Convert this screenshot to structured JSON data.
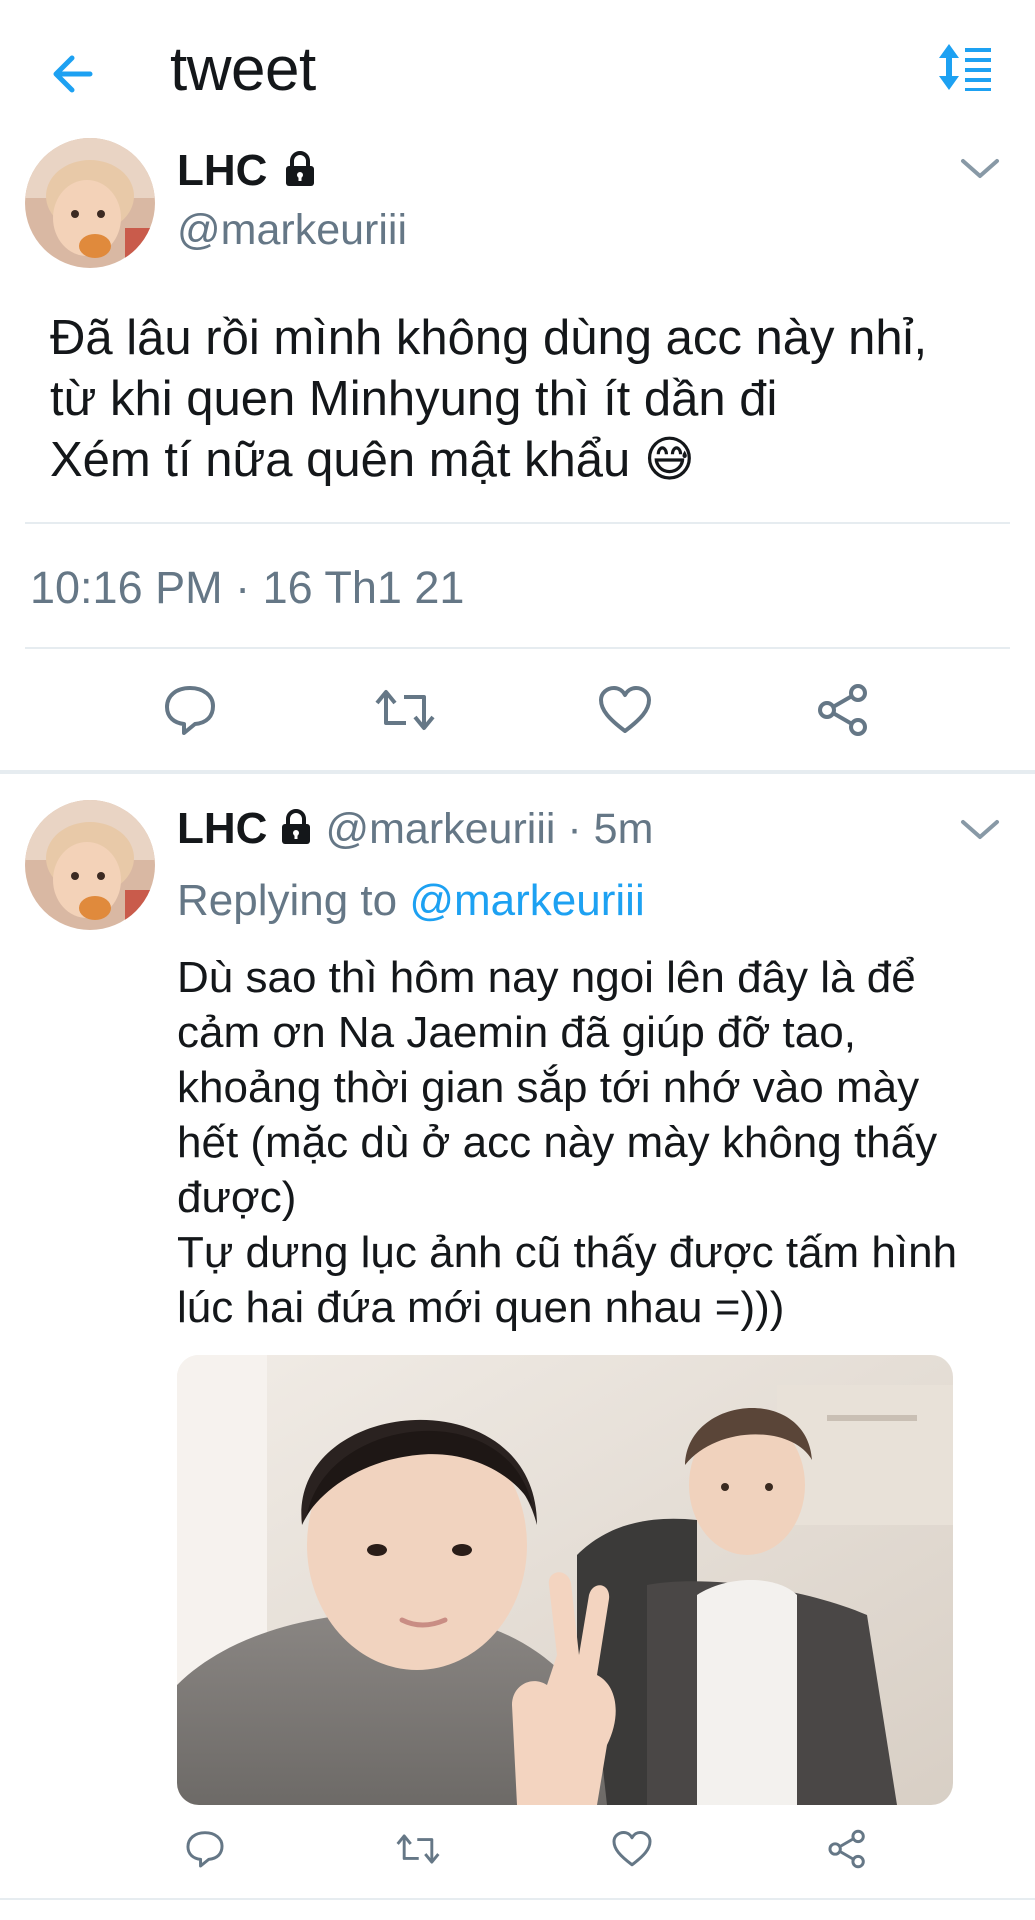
{
  "header": {
    "title": "tweet",
    "accent_color": "#1da1f2"
  },
  "main_tweet": {
    "display_name": "LHC",
    "handle": "@markeuriii",
    "text_lines": [
      "Đã lâu rồi mình không dùng acc này nhỉ,",
      "từ khi quen Minhyung thì ít dần đi",
      "Xém tí nữa quên mật khẩu"
    ],
    "emoji": "😅",
    "timestamp": "10:16 PM · 16 Th1 21"
  },
  "reply_tweet": {
    "display_name": "LHC",
    "handle_time": "@markeuriii · 5m",
    "replying_prefix": "Replying to ",
    "replying_mention": "@markeuriii",
    "text_lines": [
      "Dù sao thì hôm nay ngoi lên đây là để",
      "cảm ơn Na Jaemin đã giúp đỡ tao,",
      "khoảng thời gian sắp tới nhớ vào mày",
      "hết (mặc dù ở acc này mày không thấy",
      "được)",
      "Tự dưng lục ảnh cũ thấy được tấm hình",
      "lúc hai đứa mới quen nhau =)))"
    ]
  },
  "icons": {
    "back": "arrow-left-icon",
    "sort": "sort-icon",
    "lock": "lock-icon",
    "chevron": "chevron-down-icon",
    "reply": "reply-icon",
    "retweet": "retweet-icon",
    "like": "heart-icon",
    "share": "share-icon"
  },
  "colors": {
    "text_primary": "#14171a",
    "text_secondary": "#657786",
    "divider": "#e6ecf0",
    "accent": "#1da1f2"
  }
}
